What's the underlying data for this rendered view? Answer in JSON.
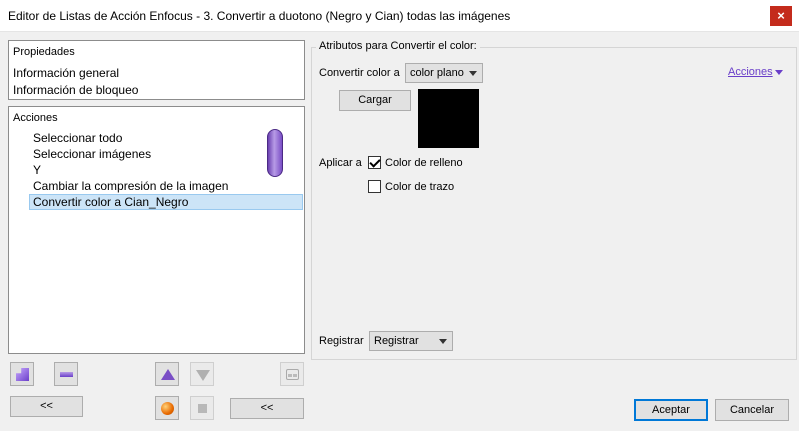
{
  "window": {
    "title": "Editor de Listas de Acción Enfocus - 3. Convertir a duotono (Negro y Cian) todas las imágenes",
    "close_glyph": "×"
  },
  "properties": {
    "title": "Propiedades",
    "items": [
      "Información general",
      "Información de bloqueo"
    ]
  },
  "actions": {
    "title": "Acciones",
    "items": [
      "Seleccionar todo",
      "Seleccionar imágenes",
      "Y",
      "Cambiar la compresión de la imagen",
      "Convertir color a Cian_Negro"
    ],
    "selected_index": 4
  },
  "attributes": {
    "group_label": "Atributos para Convertir el color:",
    "convert_label": "Convertir color a",
    "convert_value": "color plano",
    "acciones_link": "Acciones",
    "load_button": "Cargar",
    "swatch_color": "#000000",
    "apply_label": "Aplicar a",
    "fill_label": "Color de relleno",
    "fill_checked": true,
    "stroke_label": "Color de trazo",
    "stroke_checked": false,
    "register_label": "Registrar",
    "register_value": "Registrar"
  },
  "toolbar": {
    "icons": [
      "add-action-icon",
      "remove-action-icon",
      "move-up-icon",
      "move-down-icon",
      "preview-glasses-icon",
      "record-icon",
      "stop-icon"
    ],
    "collapse_left": "<<",
    "collapse_right": "<<"
  },
  "dialog": {
    "accept": "Aceptar",
    "cancel": "Cancelar"
  },
  "colors": {
    "accent": "#0078d7",
    "selection": "#cce4f7",
    "link": "#6a3fc9",
    "close": "#c42b1c"
  }
}
